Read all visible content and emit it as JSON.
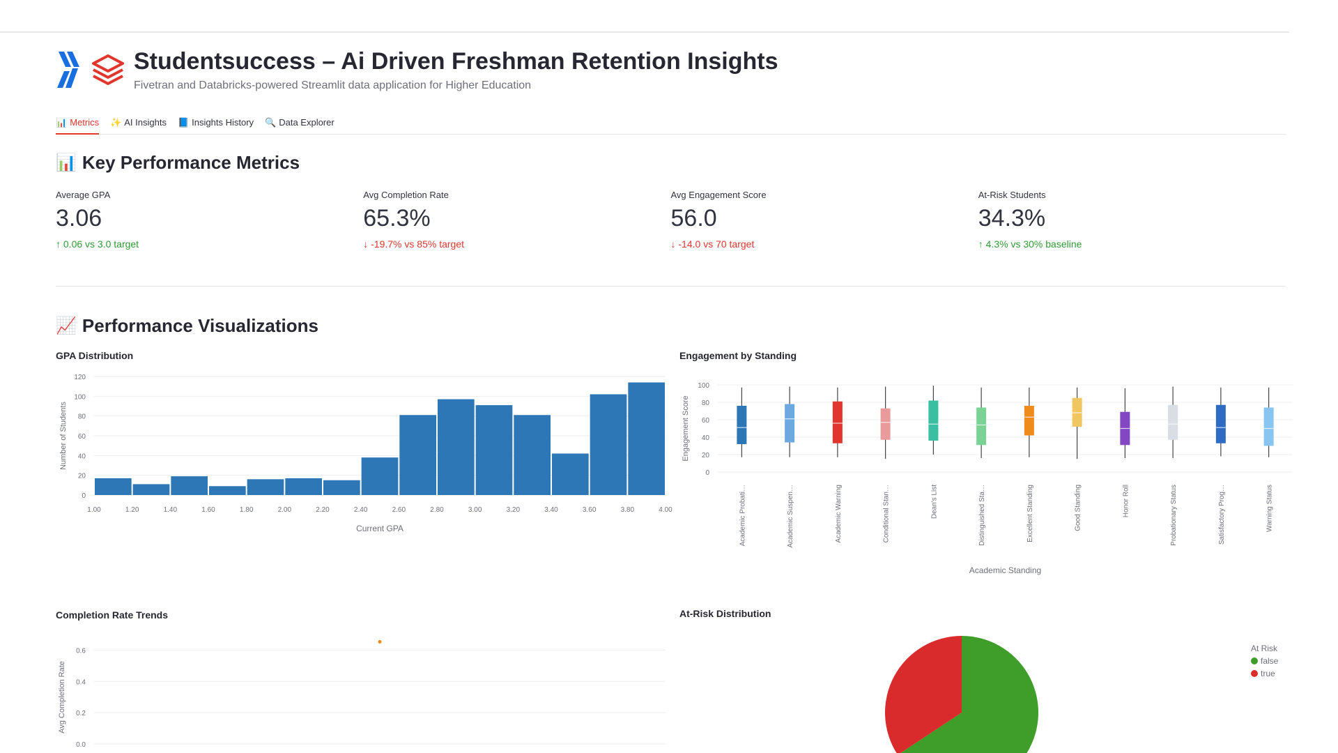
{
  "app": {
    "title": "Studentsuccess – Ai Driven Freshman Retention Insights",
    "subtitle": "Fivetran and Databricks-powered Streamlit data application for Higher Education"
  },
  "tabs": [
    {
      "label": "Metrics",
      "icon": "bar-chart-icon",
      "active": true
    },
    {
      "label": "AI Insights",
      "icon": "sparkles-icon",
      "active": false
    },
    {
      "label": "Insights History",
      "icon": "book-icon",
      "active": false
    },
    {
      "label": "Data Explorer",
      "icon": "magnifier-icon",
      "active": false
    }
  ],
  "sections": {
    "kpi_title": "Key Performance Metrics",
    "viz_title": "Performance Visualizations"
  },
  "metrics": [
    {
      "label": "Average GPA",
      "value": "3.06",
      "delta": "0.06 vs 3.0 target",
      "direction": "up"
    },
    {
      "label": "Avg Completion Rate",
      "value": "65.3%",
      "delta": "-19.7% vs 85% target",
      "direction": "down"
    },
    {
      "label": "Avg Engagement Score",
      "value": "56.0",
      "delta": "-14.0 vs 70 target",
      "direction": "down"
    },
    {
      "label": "At-Risk Students",
      "value": "34.3%",
      "delta": "4.3% vs 30% baseline",
      "direction": "up"
    }
  ],
  "colors": {
    "accent": "#e0362e",
    "positive": "#2e9b34",
    "negative": "#e0362e",
    "bar": "#2e77b6"
  },
  "chart_data": [
    {
      "type": "bar",
      "title": "GPA Distribution",
      "xlabel": "Current GPA",
      "ylabel": "Number of Students",
      "ylim": [
        0,
        120
      ],
      "yticks": [
        "0",
        "20",
        "40",
        "60",
        "80",
        "100",
        "120"
      ],
      "xticks": [
        "1.00",
        "1.20",
        "1.40",
        "1.60",
        "1.80",
        "2.00",
        "2.20",
        "2.40",
        "2.60",
        "2.80",
        "3.00",
        "3.20",
        "3.40",
        "3.60",
        "3.80",
        "4.00"
      ],
      "bins": [
        1.0,
        1.2,
        1.4,
        1.6,
        1.8,
        2.0,
        2.2,
        2.4,
        2.6,
        2.8,
        3.0,
        3.2,
        3.4,
        3.6,
        3.8,
        4.0
      ],
      "values": [
        17,
        11,
        19,
        9,
        16,
        17,
        15,
        38,
        81,
        97,
        91,
        81,
        42,
        102,
        114
      ],
      "grid": true
    },
    {
      "type": "box",
      "title": "Engagement by Standing",
      "xlabel": "Academic Standing",
      "ylabel": "Engagement Score",
      "ylim": [
        0,
        100
      ],
      "yticks": [
        "0",
        "20",
        "40",
        "60",
        "80",
        "100"
      ],
      "categories": [
        "Academic Probati…",
        "Academic Suspen…",
        "Academic Warning",
        "Conditional Stan…",
        "Dean's List",
        "Distinguished Sta…",
        "Excellent Standing",
        "Good Standing",
        "Honor Roll",
        "Probationary Status",
        "Satisfactory Prog…",
        "Warning Status"
      ],
      "colors": [
        "#2e77b6",
        "#6ba9e0",
        "#e0362e",
        "#e99a9a",
        "#3bbfa2",
        "#7ad395",
        "#ef8a1c",
        "#f0c660",
        "#8347c3",
        "#d9dde4",
        "#2e6cc4",
        "#88c5f0"
      ],
      "boxes": [
        {
          "min": 17,
          "q1": 32,
          "median": 51,
          "q3": 76,
          "max": 97
        },
        {
          "min": 17,
          "q1": 34,
          "median": 61,
          "q3": 78,
          "max": 98
        },
        {
          "min": 17,
          "q1": 33,
          "median": 56,
          "q3": 81,
          "max": 97
        },
        {
          "min": 15,
          "q1": 37,
          "median": 57,
          "q3": 73,
          "max": 98
        },
        {
          "min": 20,
          "q1": 36,
          "median": 55,
          "q3": 82,
          "max": 99
        },
        {
          "min": 16,
          "q1": 31,
          "median": 54,
          "q3": 74,
          "max": 97
        },
        {
          "min": 17,
          "q1": 42,
          "median": 63,
          "q3": 76,
          "max": 97
        },
        {
          "min": 15,
          "q1": 52,
          "median": 68,
          "q3": 85,
          "max": 97
        },
        {
          "min": 16,
          "q1": 31,
          "median": 50,
          "q3": 69,
          "max": 96
        },
        {
          "min": 16,
          "q1": 37,
          "median": 55,
          "q3": 77,
          "max": 98
        },
        {
          "min": 18,
          "q1": 33,
          "median": 51,
          "q3": 77,
          "max": 97
        },
        {
          "min": 17,
          "q1": 30,
          "median": 50,
          "q3": 74,
          "max": 97
        }
      ]
    },
    {
      "type": "scatter",
      "title": "Completion Rate Trends",
      "xlabel": "",
      "ylabel": "Avg Completion Rate",
      "ylim": [
        0,
        0.7
      ],
      "yticks": [
        "0.0",
        "0.2",
        "0.4",
        "0.6"
      ],
      "yvals": [
        0,
        0.2,
        0.4,
        0.6
      ],
      "points": [
        {
          "x": 0.5,
          "y": 0.653
        }
      ],
      "color": "#ef8a1c"
    },
    {
      "type": "pie",
      "title": "At-Risk Distribution",
      "legend_title": "At Risk",
      "legend_position": "top-right",
      "slices": [
        {
          "label": "false",
          "value": 65.7,
          "color": "#3f9d2a"
        },
        {
          "label": "true",
          "value": 34.3,
          "color": "#d92b2b"
        }
      ]
    }
  ]
}
